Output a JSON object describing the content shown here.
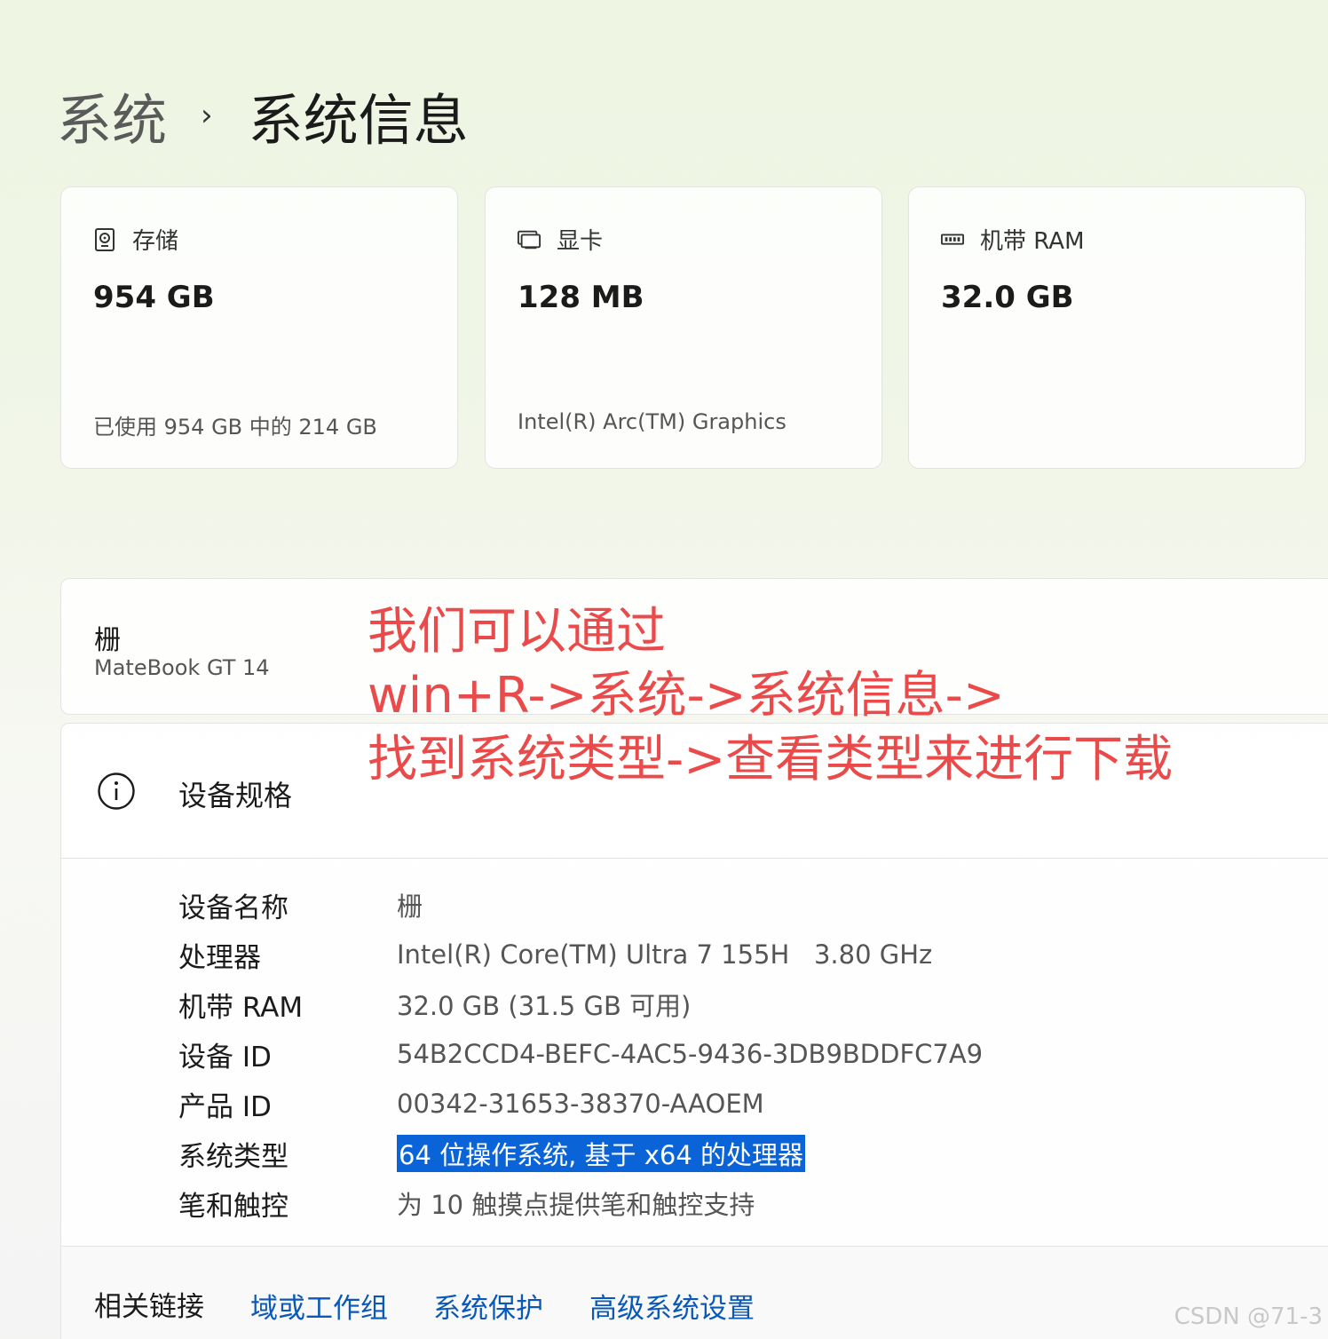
{
  "breadcrumb": {
    "parent": "系统",
    "separator": "›",
    "current": "系统信息"
  },
  "cards": [
    {
      "icon": "hard-drive-icon",
      "title": "存储",
      "value": "954 GB",
      "sub": "已使用 954 GB 中的 214 GB"
    },
    {
      "icon": "display-icon",
      "title": "显卡",
      "value": "128 MB",
      "sub": "Intel(R) Arc(TM) Graphics"
    },
    {
      "icon": "ram-icon",
      "title": "机带 RAM",
      "value": "32.0 GB",
      "sub": ""
    }
  ],
  "device": {
    "name": "栅",
    "model": "MateBook GT 14"
  },
  "specs": {
    "title": "设备规格",
    "rows": [
      {
        "label": "设备名称",
        "value": "栅"
      },
      {
        "label": "处理器",
        "value": "Intel(R) Core(TM) Ultra 7 155H   3.80 GHz"
      },
      {
        "label": "机带 RAM",
        "value": "32.0 GB (31.5 GB 可用)"
      },
      {
        "label": "设备 ID",
        "value": "54B2CCD4-BEFC-4AC5-9436-3DB9BDDFC7A9"
      },
      {
        "label": "产品 ID",
        "value": "00342-31653-38370-AAOEM"
      },
      {
        "label": "系统类型",
        "value": "64 位操作系统, 基于 x64 的处理器"
      },
      {
        "label": "笔和触控",
        "value": "为 10 触摸点提供笔和触控支持"
      }
    ]
  },
  "related": {
    "label": "相关链接",
    "links": [
      "域或工作组",
      "系统保护",
      "高级系统设置"
    ]
  },
  "annotation": {
    "lines": [
      "我们可以通过",
      "win+R->系统->系统信息->",
      "找到系统类型->查看类型来进行下载"
    ]
  },
  "watermark": "CSDN @71-3",
  "colors": {
    "link": "#0a58b8",
    "selection": "#0a64d8",
    "annotation": "#ea4a4a"
  }
}
